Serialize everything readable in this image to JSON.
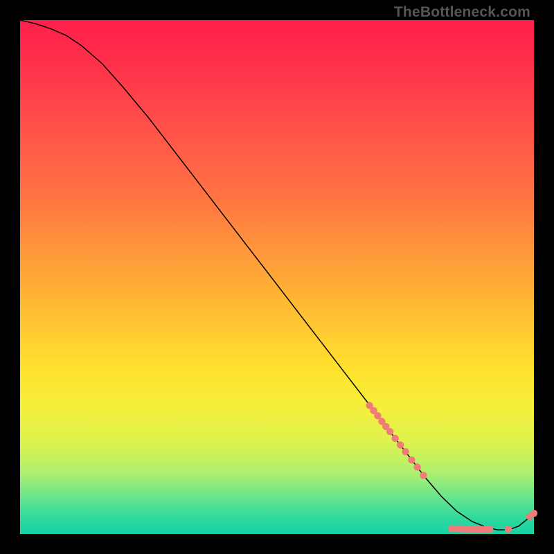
{
  "watermark": "TheBottleneck.com",
  "chart_data": {
    "type": "line",
    "title": "",
    "xlabel": "",
    "ylabel": "",
    "xlim": [
      0,
      100
    ],
    "ylim": [
      0,
      100
    ],
    "grid": false,
    "legend": false,
    "series": [
      {
        "name": "curve",
        "x": [
          0,
          3,
          6,
          9,
          12,
          16,
          20,
          25,
          30,
          35,
          40,
          45,
          50,
          55,
          60,
          65,
          70,
          73,
          76,
          79,
          82,
          85,
          88,
          91,
          93,
          95,
          97,
          99,
          100
        ],
        "y": [
          100,
          99.3,
          98.3,
          97.0,
          95.0,
          91.5,
          87.0,
          81.0,
          74.5,
          68.0,
          61.5,
          55.0,
          48.5,
          42.0,
          35.5,
          29.0,
          22.5,
          18.6,
          14.7,
          10.8,
          7.3,
          4.4,
          2.4,
          1.2,
          0.8,
          0.8,
          1.5,
          3.1,
          4.0
        ]
      }
    ],
    "dots": {
      "name": "data-points",
      "color": "#ef7c78",
      "radius": 5.2,
      "points": [
        {
          "x": 68.0,
          "y": 25.0
        },
        {
          "x": 68.8,
          "y": 24.0
        },
        {
          "x": 69.6,
          "y": 23.0
        },
        {
          "x": 70.4,
          "y": 21.9
        },
        {
          "x": 71.2,
          "y": 20.9
        },
        {
          "x": 72.0,
          "y": 19.9
        },
        {
          "x": 73.0,
          "y": 18.6
        },
        {
          "x": 74.0,
          "y": 17.3
        },
        {
          "x": 75.0,
          "y": 16.0
        },
        {
          "x": 76.2,
          "y": 14.4
        },
        {
          "x": 77.3,
          "y": 13.0
        },
        {
          "x": 78.5,
          "y": 11.4
        },
        {
          "x": 84.0,
          "y": 1.0
        },
        {
          "x": 85.0,
          "y": 1.0
        },
        {
          "x": 85.8,
          "y": 1.0
        },
        {
          "x": 86.6,
          "y": 0.9
        },
        {
          "x": 87.4,
          "y": 0.9
        },
        {
          "x": 88.2,
          "y": 0.9
        },
        {
          "x": 89.0,
          "y": 0.9
        },
        {
          "x": 89.8,
          "y": 0.9
        },
        {
          "x": 90.6,
          "y": 0.9
        },
        {
          "x": 91.4,
          "y": 0.9
        },
        {
          "x": 95.0,
          "y": 0.9
        },
        {
          "x": 99.2,
          "y": 3.4
        },
        {
          "x": 100.0,
          "y": 4.0
        }
      ]
    }
  }
}
